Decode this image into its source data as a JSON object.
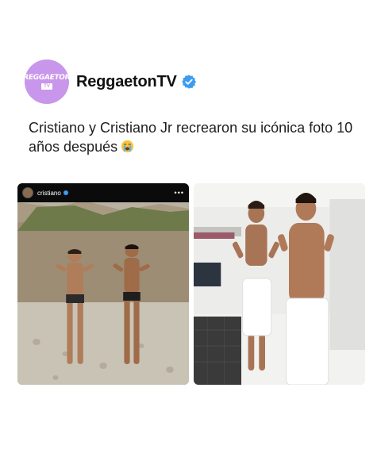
{
  "account": {
    "name": "ReggaetonTV",
    "logo_text_top": "REGGAETON",
    "logo_text_bottom": "TV",
    "avatar_color": "#c896ea",
    "verified_color": "#3d9bf0"
  },
  "post": {
    "caption": "Cristiano y Cristiano Jr recrearon su icónica foto 10 años después",
    "caption_emoji": "loudly-crying-face-emoji"
  },
  "photos": {
    "left": {
      "instagram_username": "cristiano",
      "more_glyph": "•••"
    }
  }
}
